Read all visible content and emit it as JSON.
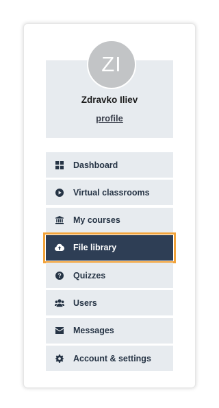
{
  "user": {
    "initials": "ZI",
    "name": "Zdravko Iliev",
    "profile_link": "profile"
  },
  "menu": {
    "items": [
      {
        "label": "Dashboard",
        "icon": "dashboard-grid-icon",
        "active": false
      },
      {
        "label": "Virtual classrooms",
        "icon": "play-circle-icon",
        "active": false
      },
      {
        "label": "My courses",
        "icon": "institution-icon",
        "active": false
      },
      {
        "label": "File library",
        "icon": "cloud-upload-icon",
        "active": true
      },
      {
        "label": "Quizzes",
        "icon": "question-circle-icon",
        "active": false
      },
      {
        "label": "Users",
        "icon": "users-icon",
        "active": false
      },
      {
        "label": "Messages",
        "icon": "envelope-icon",
        "active": false
      },
      {
        "label": "Account & settings",
        "icon": "gear-icon",
        "active": false
      }
    ]
  },
  "colors": {
    "accent_highlight": "#f2a33a",
    "active_background": "#2e3e55",
    "item_background": "#e7ebef",
    "text_dark": "#263445",
    "avatar_background": "#c2c4c6"
  }
}
